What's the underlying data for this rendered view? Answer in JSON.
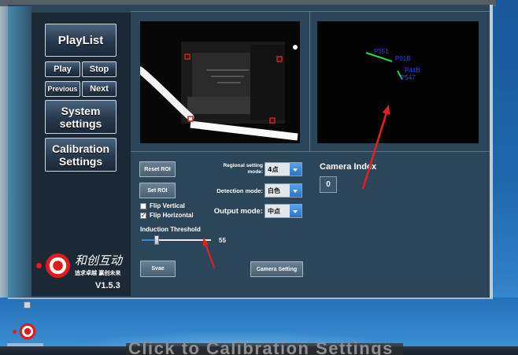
{
  "sidebar": {
    "playlist_label": "PlayList",
    "play_label": "Play",
    "stop_label": "Stop",
    "previous_label": "Previous",
    "next_label": "Next",
    "system_settings_label": [
      "System",
      "settings"
    ],
    "calibration_settings_label": [
      "Calibration",
      "Settings"
    ]
  },
  "branding": {
    "company_name": "和创互动",
    "slogan": "追求卓越 赢创未来",
    "version": "V1.5.3",
    "logo_icon": "target-logo-icon"
  },
  "preview": {
    "detected_point_labels": [
      "P551",
      "P01B",
      "P44B",
      "P547"
    ]
  },
  "controls": {
    "reset_roi_label": "Reset ROI",
    "set_roi_label": "Set ROI",
    "flip_vertical": {
      "label": "Flip Vertical",
      "checked": false
    },
    "flip_horizontal": {
      "label": "Flip Horizontal",
      "checked": true
    },
    "threshold": {
      "label": "Induction Threshold",
      "value": "55",
      "level": 0.22
    },
    "save_label": "Svae",
    "regional_mode": {
      "label_line1": "Regional setting",
      "label_line2": "mode:",
      "value": "4点"
    },
    "detection_mode": {
      "label": "Detection mode:",
      "value": "白色"
    },
    "output_mode": {
      "label": "Output mode:",
      "value": "中点"
    },
    "camera_index": {
      "label": "Camera Index",
      "value": "0"
    },
    "camera_setting_label": "Camera Setting"
  },
  "annotation": {
    "caption": "Click to Calibration Settings"
  },
  "icons": {
    "dropdown": "chevron-down-icon",
    "checkbox": "check-icon",
    "desktop_shortcut": "app-shortcut-icon",
    "desktop_logo": "target-logo-icon"
  },
  "colors": {
    "window_bg": "#2b4659",
    "sidebar_bg": "#1b2836",
    "brand_red": "#e01b1b",
    "dropdown_arrow_bg": "#2f7fd6",
    "annotation_red": "#e8201c",
    "detected_point_label": "#3344ee",
    "detected_point_marker": "#22dd44"
  }
}
